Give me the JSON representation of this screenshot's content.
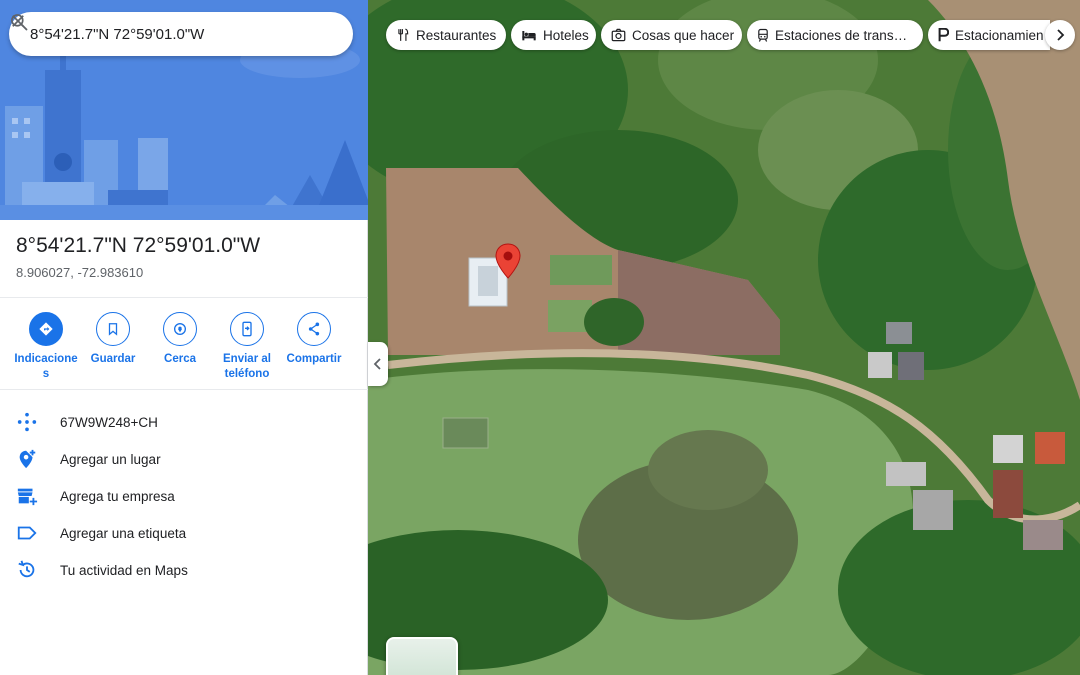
{
  "search": {
    "query": "8°54'21.7\"N 72°59'01.0\"W"
  },
  "place": {
    "title": "8°54'21.7\"N 72°59'01.0\"W",
    "decimal_coords": "8.906027, -72.983610"
  },
  "actions": [
    {
      "label": "Indicaciones",
      "icon": "directions-icon"
    },
    {
      "label": "Guardar",
      "icon": "bookmark-icon"
    },
    {
      "label": "Cerca",
      "icon": "nearby-icon"
    },
    {
      "label": "Enviar al teléfono",
      "icon": "send-to-phone-icon"
    },
    {
      "label": "Compartir",
      "icon": "share-icon"
    }
  ],
  "info_rows": {
    "plus_code_prefix": "67W9",
    "plus_code_main": "W248+CH",
    "add_place": "Agregar un lugar",
    "add_business": "Agrega tu empresa",
    "add_label": "Agregar una etiqueta",
    "activity": "Tu actividad en Maps"
  },
  "chips": [
    {
      "label": "Restaurantes",
      "icon": "restaurant-icon"
    },
    {
      "label": "Hoteles",
      "icon": "hotel-icon"
    },
    {
      "label": "Cosas que hacer",
      "icon": "camera-icon"
    },
    {
      "label": "Estaciones de trans…",
      "icon": "transit-icon"
    },
    {
      "label": "Estacionamien",
      "icon": "parking-icon"
    }
  ],
  "colors": {
    "accent": "#1a73e8",
    "pin": "#ea4335"
  }
}
